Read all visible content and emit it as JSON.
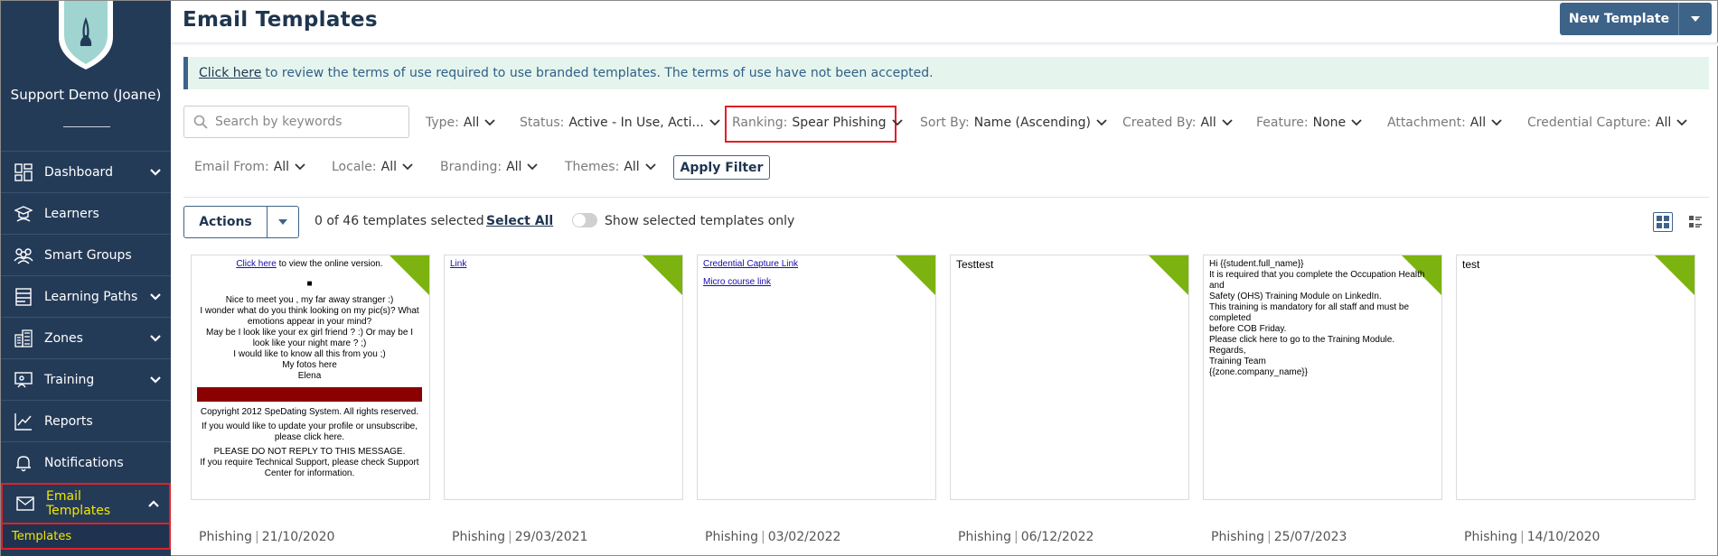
{
  "sidebar": {
    "org_name": "Support Demo (Joane)",
    "items": [
      {
        "label": "Dashboard",
        "icon": "dashboard-icon",
        "chevron": true
      },
      {
        "label": "Learners",
        "icon": "learner-icon",
        "chevron": false
      },
      {
        "label": "Smart Groups",
        "icon": "group-icon",
        "chevron": false
      },
      {
        "label": "Learning Paths",
        "icon": "learning-path-icon",
        "chevron": true
      },
      {
        "label": "Zones",
        "icon": "building-icon",
        "chevron": true
      },
      {
        "label": "Training",
        "icon": "training-icon",
        "chevron": true
      },
      {
        "label": "Reports",
        "icon": "chart-icon",
        "chevron": false
      },
      {
        "label": "Notifications",
        "icon": "bell-icon",
        "chevron": false
      },
      {
        "label": "Email Templates",
        "icon": "envelope-icon",
        "chevron": true,
        "active": true
      }
    ],
    "submenu_active": "Templates"
  },
  "header": {
    "title": "Email Templates",
    "new_template_label": "New Template"
  },
  "notice": {
    "link": "Click here",
    "text": "to review the terms of use required to use branded templates. The terms of use have not been accepted."
  },
  "filters": {
    "search_placeholder": "Search by keywords",
    "row1": [
      {
        "label": "Type:",
        "value": "All"
      },
      {
        "label": "Status:",
        "value": "Active - In Use, Acti..."
      },
      {
        "label": "Ranking:",
        "value": "Spear Phishing"
      },
      {
        "label": "Sort By:",
        "value": "Name (Ascending)"
      },
      {
        "label": "Created By:",
        "value": "All"
      },
      {
        "label": "Feature:",
        "value": "None"
      },
      {
        "label": "Attachment:",
        "value": "All"
      },
      {
        "label": "Credential Capture:",
        "value": "All"
      }
    ],
    "row2": [
      {
        "label": "Email From:",
        "value": "All"
      },
      {
        "label": "Locale:",
        "value": "All"
      },
      {
        "label": "Branding:",
        "value": "All"
      },
      {
        "label": "Themes:",
        "value": "All"
      }
    ],
    "apply_label": "Apply Filter"
  },
  "toolbar": {
    "actions_label": "Actions",
    "selected_count": "0 of 46 templates selected",
    "select_all": "Select All",
    "show_selected": "Show selected templates only"
  },
  "cards": [
    {
      "category": "Phishing",
      "date": "21/10/2020",
      "mini": {
        "online_link": "Click here",
        "online_text": "to view the online version.",
        "lines": [
          "Nice to meet you , my far away stranger :)",
          "I wonder what do you think looking on my pic(s)? What emotions appear in your mind?",
          "May be I look like your ex girl friend ? :) Or may be I look like your night mare ? ;)",
          "I would like to know all this from you ;)",
          "My fotos here",
          "Elena"
        ],
        "footer": [
          "Copyright 2012 SpeDating System. All rights reserved.",
          "If you would like to update your profile or unsubscribe, please click here.",
          "PLEASE DO NOT REPLY TO THIS MESSAGE.",
          "If you require Technical Support, please check Support Center for information."
        ]
      }
    },
    {
      "category": "Phishing",
      "date": "29/03/2021",
      "lines": [
        {
          "text": "Link",
          "link": true
        }
      ]
    },
    {
      "category": "Phishing",
      "date": "03/02/2022",
      "lines": [
        {
          "text": "Credential Capture Link",
          "link": true
        },
        {
          "text": "",
          "link": false
        },
        {
          "text": "Micro course link",
          "link": true
        }
      ]
    },
    {
      "category": "Phishing",
      "date": "06/12/2022",
      "lines": [
        {
          "text": "Testtest",
          "link": false
        }
      ]
    },
    {
      "category": "Phishing",
      "date": "25/07/2023",
      "lines": [
        {
          "text": "Hi {{student.full_name}}",
          "link": false
        },
        {
          "text": "It is required that you complete the Occupation Health and",
          "link": false
        },
        {
          "text": "Safety (OHS) Training Module on LinkedIn.",
          "link": false
        },
        {
          "text": "This training is mandatory for all staff and must be completed",
          "link": false
        },
        {
          "text": "before COB Friday.",
          "link": false
        },
        {
          "text": "Please click here to go to the Training Module.",
          "link": false
        },
        {
          "text": "Regards,",
          "link": false
        },
        {
          "text": "Training Team",
          "link": false
        },
        {
          "text": "{{zone.company_name}}",
          "link": false
        }
      ]
    },
    {
      "category": "Phishing",
      "date": "14/10/2020",
      "lines": [
        {
          "text": "test",
          "link": false
        }
      ]
    }
  ],
  "colors": {
    "sidebar_bg": "#243b58",
    "accent": "#3e6389",
    "active_text": "#f2e600",
    "highlight_border": "#e12026",
    "corner_ribbon": "#7cb310",
    "notice_bg": "#e5f5ee"
  }
}
